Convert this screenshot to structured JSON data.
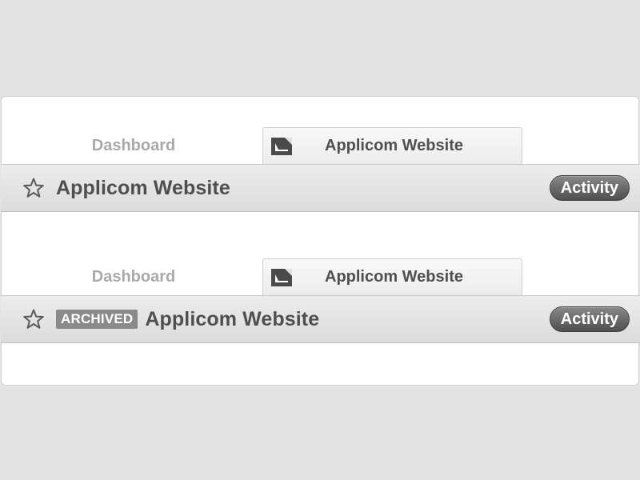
{
  "headers": [
    {
      "tabs": {
        "dashboard_label": "Dashboard",
        "project_label": "Applicom Website",
        "project_icon": "document-icon"
      },
      "bar": {
        "star_icon": "star-outline-icon",
        "badge": null,
        "title": "Applicom Website",
        "activity_label": "Activity"
      }
    },
    {
      "tabs": {
        "dashboard_label": "Dashboard",
        "project_label": "Applicom Website",
        "project_icon": "document-icon"
      },
      "bar": {
        "star_icon": "star-outline-icon",
        "badge": "ARCHIVED",
        "title": "Applicom Website",
        "activity_label": "Activity"
      }
    }
  ],
  "colors": {
    "page_bg": "#e3e3e3",
    "card_bg": "#ffffff",
    "bar_bg": "#e4e4e4",
    "text_dark": "#4f4f4f",
    "text_muted": "#a9a9a9",
    "badge_bg": "#8a8a8a",
    "activity_bg": "#5e5e5e"
  }
}
